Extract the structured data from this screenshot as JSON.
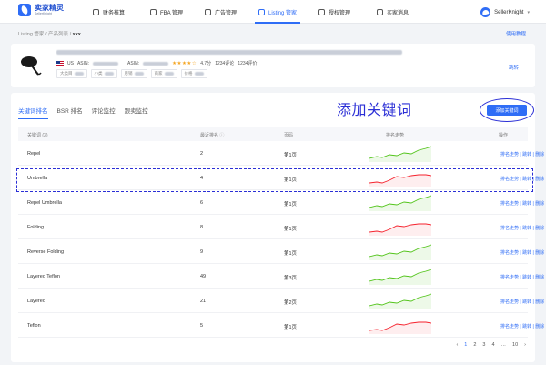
{
  "brand": {
    "name_cn": "卖家精灵",
    "name_en": "SellerKnight"
  },
  "nav": [
    {
      "label": "财务核算",
      "icon": "finance-icon",
      "active": false
    },
    {
      "label": "FBA 管理",
      "icon": "box-icon",
      "active": false
    },
    {
      "label": "广告管理",
      "icon": "ads-icon",
      "active": false
    },
    {
      "label": "Listing 管家",
      "icon": "listing-icon",
      "active": true
    },
    {
      "label": "授权管理",
      "icon": "auth-icon",
      "active": false
    },
    {
      "label": "买家消息",
      "icon": "message-icon",
      "active": false
    }
  ],
  "user": {
    "name": "SellerKnight"
  },
  "breadcrumb": {
    "part1": "Listing 管家",
    "part2": "产品列表",
    "current": "xxx"
  },
  "tutorial_link": "使用教程",
  "product": {
    "market": "US",
    "asin_label": "ASIN:",
    "asin2_label": "ASIN:",
    "stars": "★★★★☆",
    "rating": "4.7分",
    "reviews": "1234评论",
    "sales": "1234评价",
    "tags": [
      "大类目",
      "小类",
      "月销",
      "商家",
      "价格"
    ],
    "jump_link": "跳转"
  },
  "tabs": [
    "关键词排名",
    "BSR 排名",
    "评论监控",
    "跟卖监控"
  ],
  "annotation": "添加关键词",
  "add_button": "添加关键词",
  "table": {
    "headers": {
      "keyword": "关键词 (3)",
      "rank": "最近排名",
      "page": "页码",
      "trend": "排名走势",
      "ops": "操作"
    },
    "rows": [
      {
        "keyword": "Repel",
        "rank": "2",
        "page": "第1页",
        "trend": "up",
        "color": "#52c41a"
      },
      {
        "keyword": "Umbrella",
        "rank": "4",
        "page": "第1页",
        "trend": "flat",
        "color": "#f5222d"
      },
      {
        "keyword": "Repel Umbrella",
        "rank": "6",
        "page": "第1页",
        "trend": "up",
        "color": "#52c41a"
      },
      {
        "keyword": "Folding",
        "rank": "8",
        "page": "第1页",
        "trend": "flat",
        "color": "#f5222d"
      },
      {
        "keyword": "Reverse Folding",
        "rank": "9",
        "page": "第1页",
        "trend": "up",
        "color": "#52c41a"
      },
      {
        "keyword": "Layered Teflon",
        "rank": "49",
        "page": "第3页",
        "trend": "up",
        "color": "#52c41a"
      },
      {
        "keyword": "Layered",
        "rank": "21",
        "page": "第2页",
        "trend": "up",
        "color": "#52c41a"
      },
      {
        "keyword": "Teflon",
        "rank": "5",
        "page": "第1页",
        "trend": "flat",
        "color": "#f5222d"
      }
    ],
    "op_labels": [
      "排名走势",
      "跳转",
      "删除"
    ]
  },
  "pagination": [
    "‹",
    "1",
    "2",
    "3",
    "4",
    "…",
    "10",
    "›"
  ]
}
